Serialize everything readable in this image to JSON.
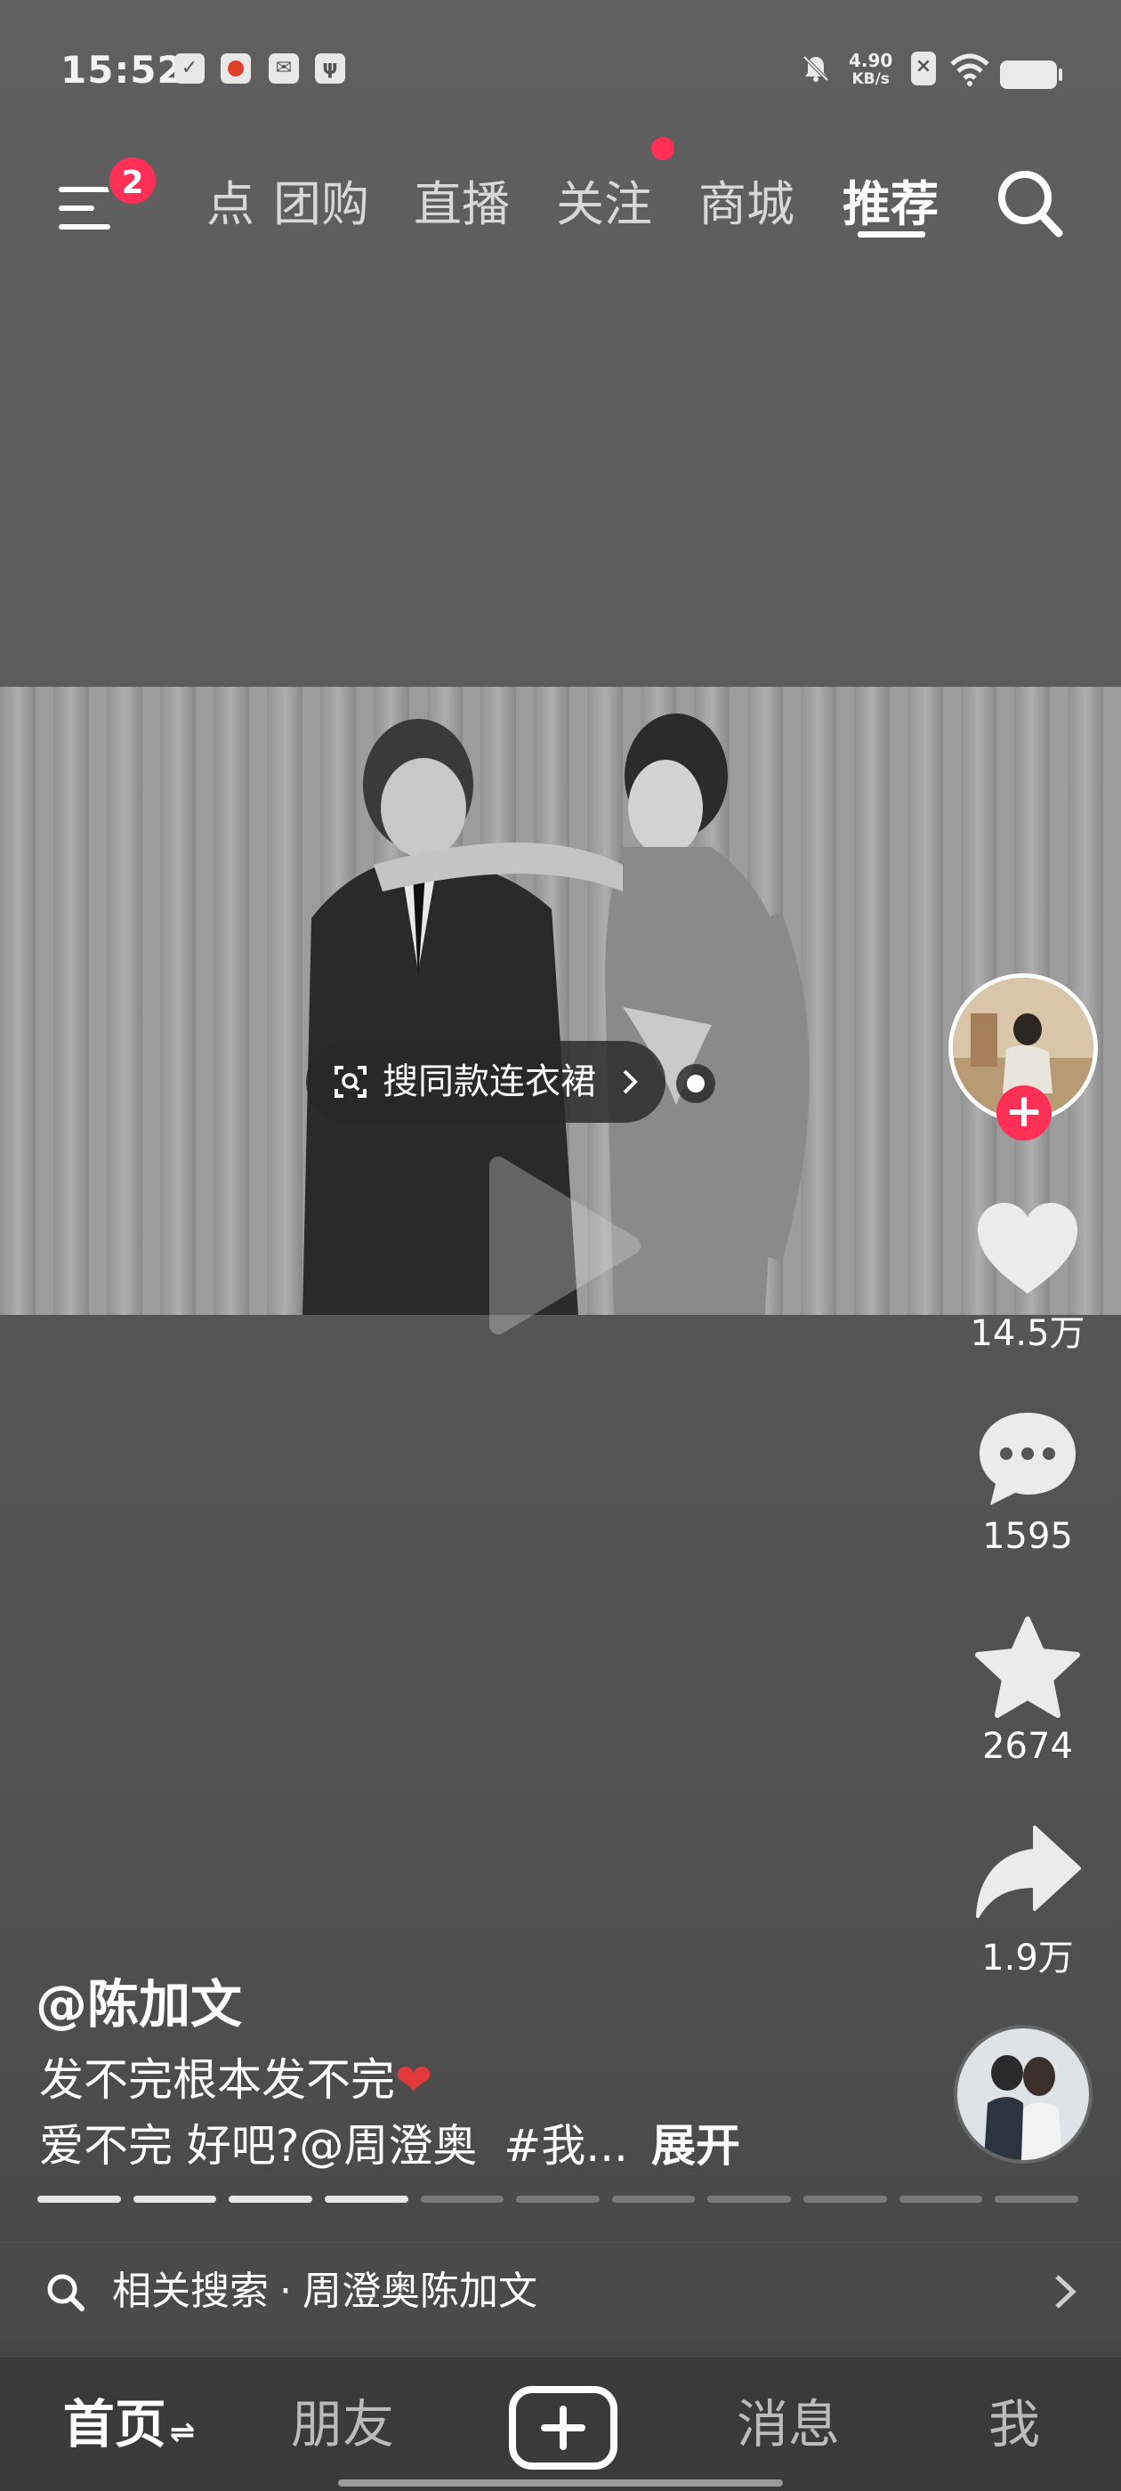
{
  "status_bar": {
    "time": "15:52",
    "net_speed_value": "4.90",
    "net_speed_unit": "KB/s",
    "icons": [
      "checkbox-icon",
      "app-notification-icon",
      "mail-icon",
      "usb-debug-icon",
      "mute-bell-icon",
      "no-sim-icon",
      "wifi-icon",
      "battery-icon"
    ]
  },
  "top_nav": {
    "menu_badge": "2",
    "tabs": [
      {
        "label": "热点",
        "visible_label": "点"
      },
      {
        "label": "团购"
      },
      {
        "label": "直播"
      },
      {
        "label": "关注"
      },
      {
        "label": "商城"
      },
      {
        "label": "推荐"
      }
    ],
    "active_tab": "推荐"
  },
  "video": {
    "shop_tag": "搜同款连衣裙"
  },
  "right_rail": {
    "likes": "14.5万",
    "comments": "1595",
    "favorites": "2674",
    "shares": "1.9万"
  },
  "caption": {
    "author": "@陈加文",
    "line1": "发不完根本发不完",
    "line2": "爱不完 好吧?@周澄奥",
    "hashtag": "#我...",
    "expand": "展开"
  },
  "progress": {
    "total_segments": 11,
    "watched_segments": 4
  },
  "related_search": {
    "label": "相关搜索",
    "dot": "·",
    "query": "周澄奥陈加文"
  },
  "bottom_nav": {
    "home": "首页",
    "friends": "朋友",
    "messages": "消息",
    "me": "我"
  },
  "colors": {
    "accent": "#ff2f55",
    "background": "#5c5c5c",
    "bottom_bar": "#3a3a3a"
  }
}
